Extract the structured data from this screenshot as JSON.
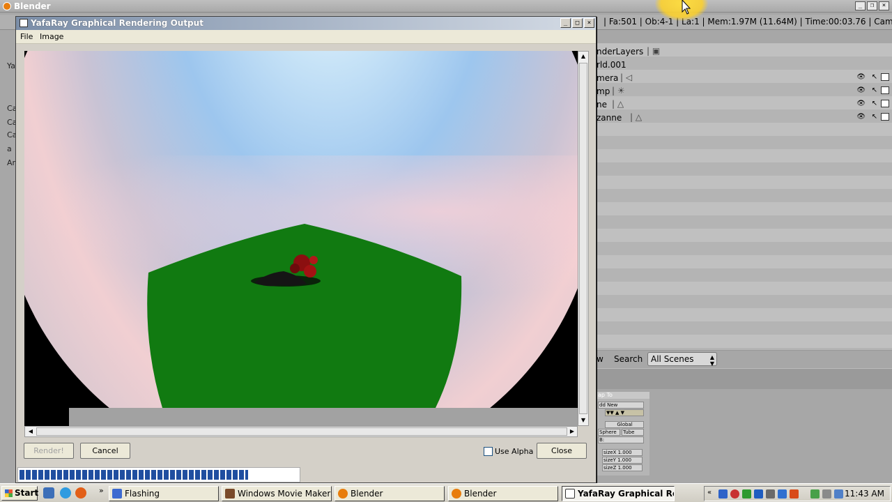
{
  "blender": {
    "title": "Blender",
    "info_bar": "| Fa:501 | Ob:4-1 | La:1 | Mem:1.97M (11.64M) | Time:00:03.76 | Camera",
    "left_panel_labels": [
      "Ya",
      "Ca",
      "Ca",
      "Ca",
      "a",
      "Ar"
    ],
    "outliner": {
      "rows": [
        {
          "label": "nderLayers",
          "icon": "render-layers-icon"
        },
        {
          "label": "rld.001",
          "icon": ""
        },
        {
          "label": "mera",
          "icon": "camera-icon"
        },
        {
          "label": "mp",
          "icon": "lamp-icon"
        },
        {
          "label": "ne",
          "icon": "mesh-icon"
        },
        {
          "label": "zanne",
          "icon": "mesh-icon"
        }
      ]
    },
    "search": {
      "view_label": "w",
      "label": "Search",
      "scope": "All Scenes"
    },
    "tool_panel": {
      "header": "ap To",
      "add_new": "dd New",
      "global": "Global",
      "sphere": "Sphere",
      "tube": "Tube",
      "b": "B:",
      "sizes": [
        "sizeX 1.000",
        "sizeY 1.000",
        "sizeZ 1.000"
      ]
    }
  },
  "yafaray": {
    "title": "YafaRay Graphical Rendering Output",
    "menu": {
      "file": "File",
      "image": "Image"
    },
    "render_label": "Render!",
    "cancel_label": "Cancel",
    "use_alpha_label": "Use Alpha",
    "close_label": "Close",
    "progress": 0.82
  },
  "taskbar": {
    "start": "Start",
    "tasks": [
      {
        "label": "Flashing",
        "active": false
      },
      {
        "label": "Windows Movie Maker",
        "active": false
      },
      {
        "label": "Blender",
        "active": false
      },
      {
        "label": "Blender",
        "active": false
      },
      {
        "label": "YafaRay Graphical Re...",
        "active": true
      }
    ],
    "clock": "11:43 AM"
  },
  "colors": {
    "plane_green": "#117a11",
    "progress_blue": "#1f4ea0",
    "halo_yellow": "#ffd83c"
  }
}
